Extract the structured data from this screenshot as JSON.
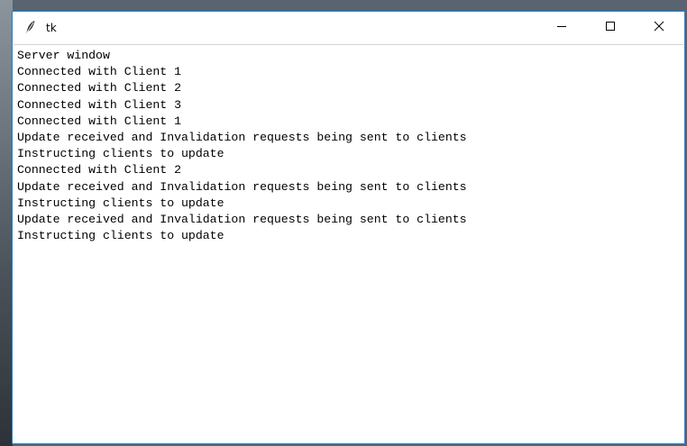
{
  "window": {
    "title": "tk",
    "accent_border": "#1883d7",
    "controls": {
      "minimize_icon": "minimize-icon",
      "maximize_icon": "maximize-icon",
      "close_icon": "close-icon"
    }
  },
  "log": {
    "lines": [
      "Server window",
      "Connected with Client 1",
      "Connected with Client 2",
      "Connected with Client 3",
      "Connected with Client 1",
      "Update received and Invalidation requests being sent to clients",
      "Instructing clients to update",
      "Connected with Client 2",
      "Update received and Invalidation requests being sent to clients",
      "Instructing clients to update",
      "Update received and Invalidation requests being sent to clients",
      "Instructing clients to update"
    ]
  }
}
